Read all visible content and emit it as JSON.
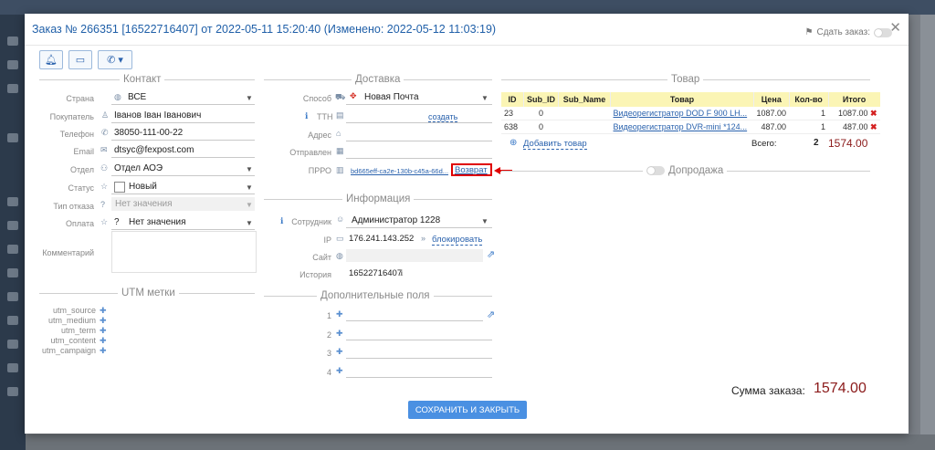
{
  "order": {
    "title": "Заказ № 266351 [16522716407] от 2022-05-11 15:20:40 (Изменено: 2022-05-12 11:03:19)",
    "handover_label": "Сдать заказ:",
    "save_button": "СОХРАНИТЬ И ЗАКРЫТЬ",
    "total_label": "Сумма заказа:",
    "total_value": "1574.00"
  },
  "sections": {
    "contact": "Контакт",
    "delivery": "Доставка",
    "goods": "Товар",
    "info": "Информация",
    "utm": "UTM метки",
    "extra": "Дополнительные поля",
    "upsell": "Допродажа"
  },
  "contact": {
    "country_label": "Страна",
    "country_value": "ВСЕ",
    "buyer_label": "Покупатель",
    "buyer_value": "Іванов Іван Іванович",
    "phone_label": "Телефон",
    "phone_value": "38050-111-00-22",
    "email_label": "Email",
    "email_value": "dtsyc@fexpost.com",
    "dept_label": "Отдел",
    "dept_value": "Отдел АОЭ",
    "status_label": "Статус",
    "status_value": "Новый",
    "refusal_label": "Тип отказа",
    "refusal_value": "Нет значения",
    "payment_label": "Оплата",
    "payment_value": "Нет значения",
    "comment_label": "Комментарий"
  },
  "delivery": {
    "method_label": "Способ",
    "method_value": "Новая Почта",
    "ttn_label": "ТТН",
    "ttn_action": "создать",
    "address_label": "Адрес",
    "sent_label": "Отправлен",
    "prro_label": "ПРРО",
    "prro_value": "bd665eff-ca2e-130b-c45a-66d...",
    "prro_return": "Возврат"
  },
  "info": {
    "employee_label": "Сотрудник",
    "employee_value": "Администратор 1228",
    "ip_label": "IP",
    "ip_value": "176.241.143.252",
    "ip_block": "блокировать",
    "site_label": "Сайт",
    "history_label": "История",
    "history_value": "16522716407"
  },
  "utm": [
    "utm_source",
    "utm_medium",
    "utm_term",
    "utm_content",
    "utm_campaign"
  ],
  "extra_fields": [
    "1",
    "2",
    "3",
    "4"
  ],
  "goods": {
    "headers": [
      "ID",
      "Sub_ID",
      "Sub_Name",
      "Товар",
      "Цена",
      "Кол-во",
      "Итого"
    ],
    "rows": [
      {
        "id": "23",
        "sub_id": "0",
        "sub_name": "",
        "product": "Видеорегистратор DOD F 900 LH...",
        "price": "1087.00",
        "qty": "1",
        "total": "1087.00"
      },
      {
        "id": "638",
        "sub_id": "0",
        "sub_name": "",
        "product": "Видеорегистратор DVR-mini *124...",
        "price": "487.00",
        "qty": "1",
        "total": "487.00"
      }
    ],
    "add_label": "Добавить товар",
    "sum_label": "Всего:",
    "sum_qty": "2",
    "sum_total": "1574.00"
  },
  "colors": {
    "accent": "#2a62ad",
    "total": "#8b1a1a",
    "highlight": "#e00000",
    "table_header": "#fbf5b5",
    "save": "#4a90e2"
  }
}
